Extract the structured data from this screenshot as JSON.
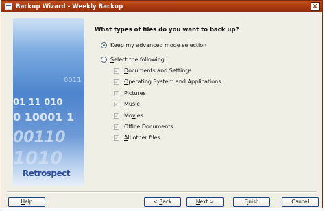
{
  "window": {
    "title": "Backup Wizard - Weekly Backup",
    "close_glyph": "×"
  },
  "side_panel": {
    "digit_lines": [
      "0011",
      "01 11 010",
      "0 10001 1",
      "00110",
      "1010"
    ],
    "logo_text": "Retrospect"
  },
  "main": {
    "question": "What types of files do you want to back up?",
    "option_advanced": {
      "accel": "K",
      "rest": "eep my advanced mode selection"
    },
    "option_select": {
      "accel": "S",
      "rest": "elect the following:"
    },
    "file_types": [
      {
        "pre": "",
        "accel": "D",
        "post": "ocuments and Settings"
      },
      {
        "pre": "",
        "accel": "O",
        "post": "perating System and Applications"
      },
      {
        "pre": "",
        "accel": "P",
        "post": "ictures"
      },
      {
        "pre": "Mu",
        "accel": "s",
        "post": "ic"
      },
      {
        "pre": "Mo",
        "accel": "v",
        "post": "ies"
      },
      {
        "pre": "Office Documents",
        "accel": "",
        "post": ""
      },
      {
        "pre": "",
        "accel": "A",
        "post": "ll other files"
      }
    ]
  },
  "footer": {
    "help": {
      "pre": "",
      "accel": "H",
      "post": "elp"
    },
    "back": {
      "pre": "< ",
      "accel": "B",
      "post": "ack"
    },
    "next": {
      "pre": "",
      "accel": "N",
      "post": "ext >"
    },
    "finish": {
      "pre": "F",
      "accel": "i",
      "post": "nish"
    },
    "cancel": {
      "pre": "Cancel",
      "accel": "",
      "post": ""
    }
  }
}
